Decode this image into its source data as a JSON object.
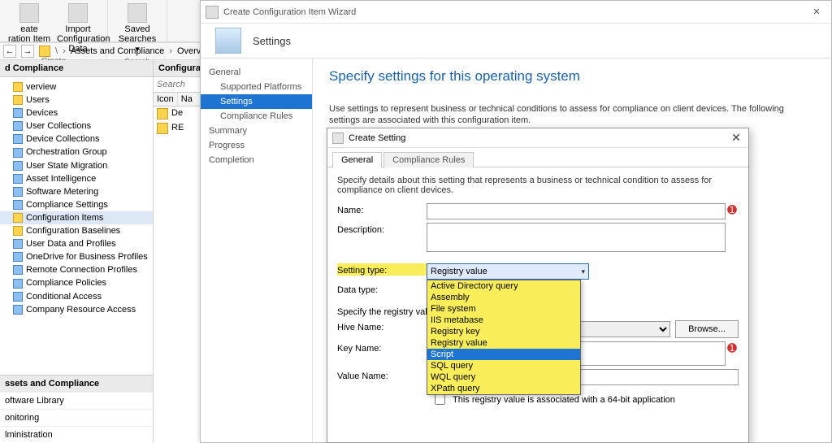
{
  "ribbon": {
    "btn_create": "eate\nration Item",
    "btn_import": "Import\nConfiguration Data",
    "btn_saved": "Saved\nSearches ▾",
    "group_create": "Create",
    "group_search": "Search"
  },
  "breadcrumb": {
    "root_icon": "›",
    "seg1": "Assets and Compliance",
    "seg2": "Overview"
  },
  "left_panel": {
    "header": "d Compliance",
    "items": [
      "verview",
      "Users",
      "Devices",
      "User Collections",
      "Device Collections",
      "Orchestration Group",
      "User State Migration",
      "Asset Intelligence",
      "Software Metering",
      "Compliance Settings",
      "Configuration Items",
      "Configuration Baselines",
      "User Data and Profiles",
      "OneDrive for Business Profiles",
      "Remote Connection Profiles",
      "Compliance Policies",
      "Conditional Access",
      "Company Resource Access"
    ],
    "active_index": 10,
    "footer": {
      "head": "ssets and Compliance",
      "links": [
        "oftware Library",
        "onitoring",
        "lministration"
      ]
    }
  },
  "center_panel": {
    "header": "Configuratio",
    "search_placeholder": "Search",
    "columns": [
      "Icon",
      "Na"
    ],
    "rows": [
      "De",
      "RE"
    ]
  },
  "wizard": {
    "title": "Create Configuration Item Wizard",
    "banner_step": "Settings",
    "nav": {
      "items": [
        {
          "label": "General",
          "indent": 0
        },
        {
          "label": "Supported Platforms",
          "indent": 1
        },
        {
          "label": "Settings",
          "indent": 1,
          "selected": true
        },
        {
          "label": "Compliance Rules",
          "indent": 1
        },
        {
          "label": "Summary",
          "indent": 0
        },
        {
          "label": "Progress",
          "indent": 0
        },
        {
          "label": "Completion",
          "indent": 0
        }
      ]
    },
    "heading": "Specify settings for this operating system",
    "help": "Use settings to represent business or technical conditions to assess for compliance on client devices. The following settings are associated with this configuration item."
  },
  "dialog": {
    "title": "Create Setting",
    "tabs": [
      "General",
      "Compliance Rules"
    ],
    "active_tab": 0,
    "help": "Specify details about this setting that represents a business or technical condition to assess for compliance on client devices.",
    "labels": {
      "name": "Name:",
      "description": "Description:",
      "setting_type": "Setting type:",
      "data_type": "Data type:",
      "specify": "Specify the registry value",
      "hive": "Hive Name:",
      "key": "Key Name:",
      "value": "Value Name:",
      "browse": "Browse...",
      "chk64": "This registry value is associated with a 64-bit application"
    },
    "setting_type_value": "Registry value",
    "setting_type_options": [
      {
        "label": "Active Directory query",
        "hi": true
      },
      {
        "label": "Assembly",
        "hi": true
      },
      {
        "label": "File system",
        "hi": true
      },
      {
        "label": "IIS metabase",
        "hi": true
      },
      {
        "label": "Registry key",
        "hi": true
      },
      {
        "label": "Registry value",
        "hi": true
      },
      {
        "label": "Script",
        "hi": true,
        "selected": true
      },
      {
        "label": "SQL query",
        "hi": true
      },
      {
        "label": "WQL query",
        "hi": true
      },
      {
        "label": "XPath query",
        "hi": true
      }
    ]
  },
  "stray": {
    "x": "✕",
    "mag": "🔍"
  }
}
